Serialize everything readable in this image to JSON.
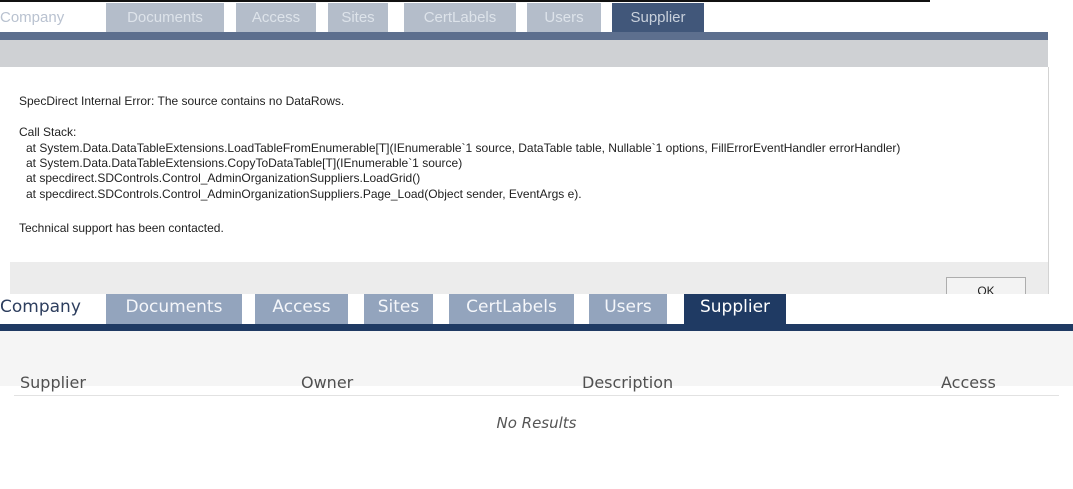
{
  "upper_tabs": [
    "Company",
    "Documents",
    "Access",
    "Sites",
    "CertLabels",
    "Users",
    "Supplier"
  ],
  "dialog": {
    "error_message": "SpecDirect Internal Error: The source contains no DataRows.",
    "call_stack_label": "Call Stack:",
    "stack_lines": [
      "at System.Data.DataTableExtensions.LoadTableFromEnumerable[T](IEnumerable`1 source, DataTable table, Nullable`1 options, FillErrorEventHandler errorHandler)",
      "at System.Data.DataTableExtensions.CopyToDataTable[T](IEnumerable`1 source)",
      "at specdirect.SDControls.Control_AdminOrganizationSuppliers.LoadGrid()",
      "at specdirect.SDControls.Control_AdminOrganizationSuppliers.Page_Load(Object sender, EventArgs e)."
    ],
    "support_message": "Technical support has been contacted.",
    "ok_label": "OK"
  },
  "lower_tabs": [
    "Company",
    "Documents",
    "Access",
    "Sites",
    "CertLabels",
    "Users",
    "Supplier"
  ],
  "table": {
    "columns": [
      "Supplier",
      "Owner",
      "Description",
      "Access"
    ],
    "empty_text": "No Results"
  },
  "colors": {
    "tab_active": "#1f3a63",
    "tab_inactive": "#93a4bd",
    "dialog_footer": "#ececec"
  }
}
